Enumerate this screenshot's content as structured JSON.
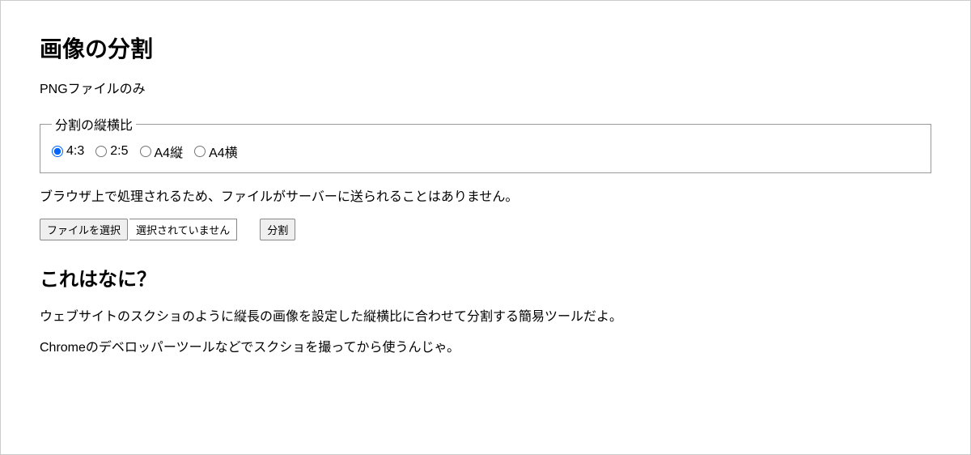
{
  "heading1": "画像の分割",
  "subtitle": "PNGファイルのみ",
  "fieldset": {
    "legend": "分割の縦横比",
    "options": [
      {
        "label": "4:3",
        "checked": true
      },
      {
        "label": "2:5",
        "checked": false
      },
      {
        "label": "A4縦",
        "checked": false
      },
      {
        "label": "A4横",
        "checked": false
      }
    ]
  },
  "note": "ブラウザ上で処理されるため、ファイルがサーバーに送られることはありません。",
  "file": {
    "choose_label": "ファイルを選択",
    "status": "選択されていません"
  },
  "split_button": "分割",
  "heading2": "これはなに？",
  "desc1": "ウェブサイトのスクショのように縦長の画像を設定した縦横比に合わせて分割する簡易ツールだよ。",
  "desc2": "Chromeのデベロッパーツールなどでスクショを撮ってから使うんじゃ。"
}
